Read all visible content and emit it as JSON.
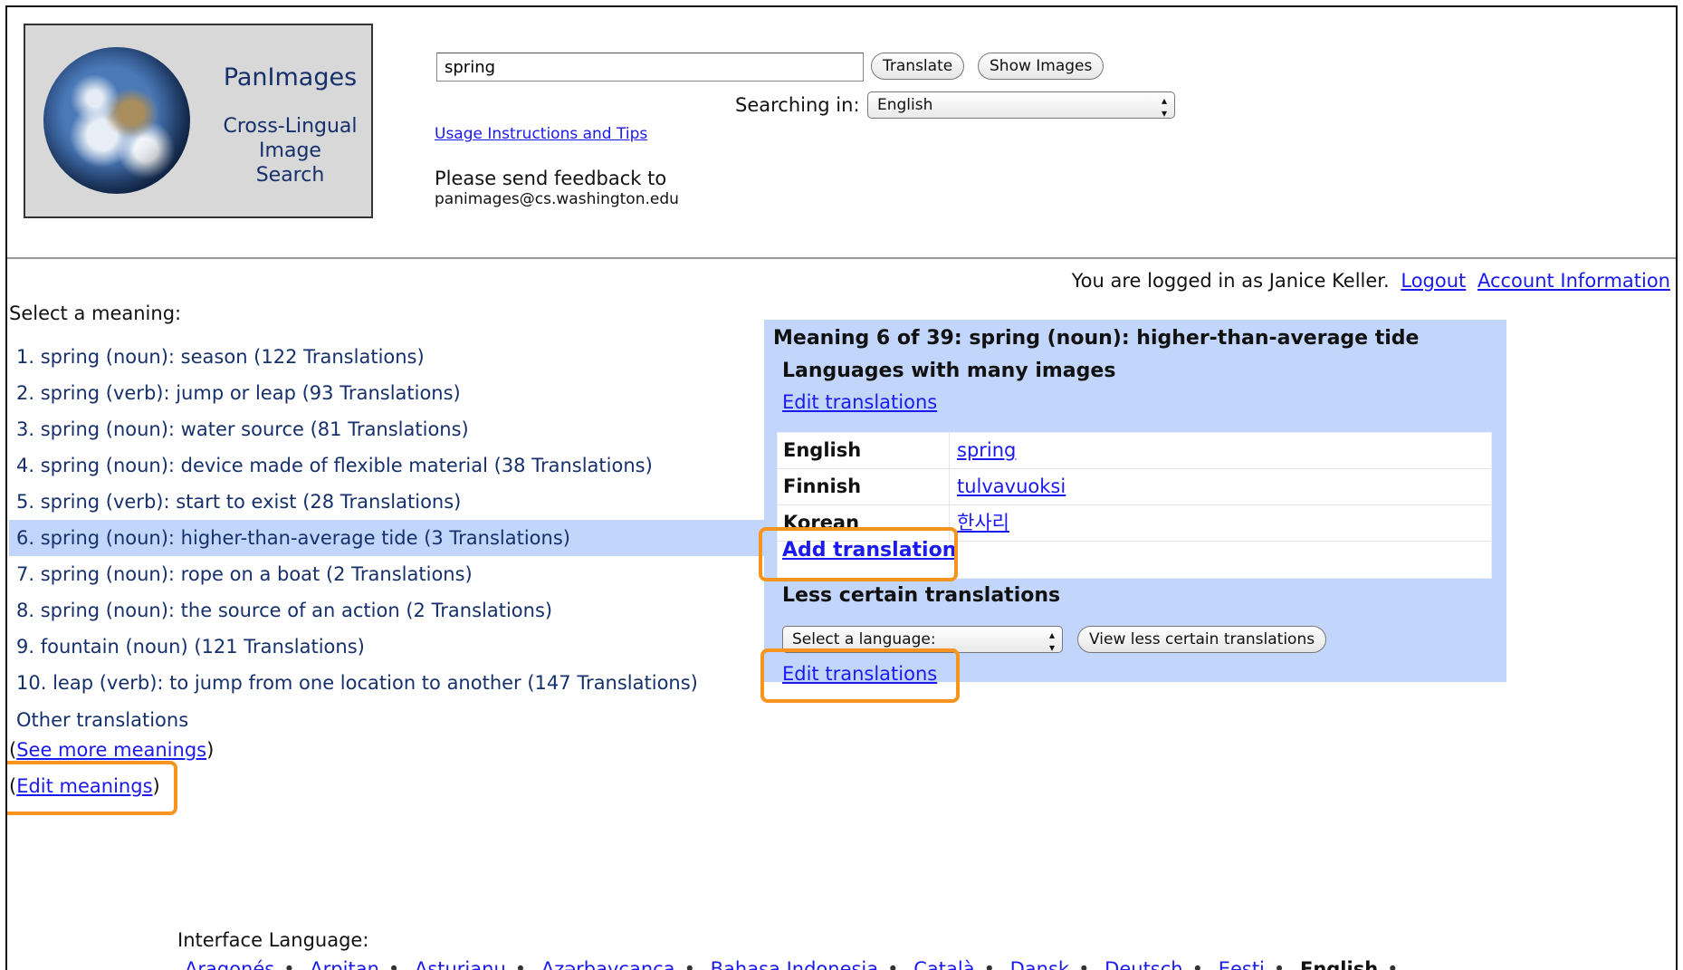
{
  "logo": {
    "title": "PanImages",
    "subtitle_lines": [
      "Cross-Lingual",
      "Image",
      "Search"
    ]
  },
  "search": {
    "query": "spring",
    "translate_label": "Translate",
    "show_images_label": "Show Images",
    "searching_in_label": "Searching in:",
    "searching_in_value": "English"
  },
  "links": {
    "usage": "Usage Instructions and Tips",
    "feedback_line1": "Please send feedback to",
    "feedback_email": "panimages@cs.washington.edu"
  },
  "account": {
    "logged_in_text": "You are logged in as Janice Keller.",
    "logout_label": "Logout",
    "account_info_label": "Account Information"
  },
  "meanings": {
    "heading": "Select a meaning:",
    "items": [
      "1. spring (noun): season (122 Translations)",
      "2. spring (verb): jump or leap (93 Translations)",
      "3. spring (noun): water source (81 Translations)",
      "4. spring (noun): device made of flexible material (38 Translations)",
      "5. spring (verb): start to exist (28 Translations)",
      "6. spring (noun): higher-than-average tide (3 Translations)",
      "7. spring (noun): rope on a boat (2 Translations)",
      "8. spring (noun): the source of an action (2 Translations)",
      "9. fountain (noun) (121 Translations)",
      "10. leap (verb): to jump from one location to another (147 Translations)"
    ],
    "selected_index": 5,
    "other_translations": "Other translations",
    "see_more_label": "See more meanings",
    "edit_meanings_label": "Edit meanings"
  },
  "panel": {
    "title": "Meaning 6 of 39: spring (noun): higher-than-average tide",
    "many_images_heading": "Languages with many images",
    "edit_translations_label": "Edit translations",
    "rows": [
      {
        "language": "English",
        "word": "spring"
      },
      {
        "language": "Finnish",
        "word": "tulvavuoksi"
      },
      {
        "language": "Korean",
        "word": "한사리"
      }
    ],
    "add_translation_label": "Add translation",
    "less_certain_heading": "Less certain translations",
    "select_language_placeholder": "Select a language:",
    "view_less_certain_label": "View less certain translations",
    "edit_translations_label_2": "Edit translations"
  },
  "interface_language": {
    "label": "Interface Language:",
    "languages": [
      "Aragonés",
      "Arpitan",
      "Asturianu",
      "Azərbaycanca",
      "Bahasa Indonesia",
      "Català",
      "Dansk",
      "Deutsch",
      "Eesti",
      "English"
    ],
    "current": "English"
  },
  "colors": {
    "highlight": "#f7941d",
    "panel_bg": "#c2d6fb",
    "link": "#1a1aee"
  }
}
